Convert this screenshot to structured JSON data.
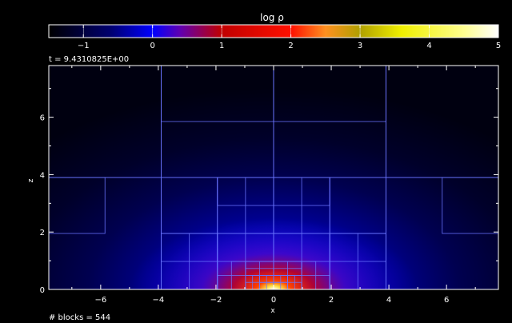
{
  "chart_data": {
    "type": "heatmap",
    "title": "log ρ",
    "colorbar": {
      "range": [
        -1.5,
        5.0
      ],
      "ticks": [
        -1,
        0,
        1,
        2,
        3,
        4,
        5
      ],
      "tick_labels": [
        "−1",
        "0",
        "1",
        "2",
        "3",
        "4",
        "5"
      ],
      "stops": [
        {
          "v": -1.5,
          "c": "#000000"
        },
        {
          "v": -0.6,
          "c": "#000070"
        },
        {
          "v": 0.0,
          "c": "#0000ff"
        },
        {
          "v": 0.4,
          "c": "#6000b0"
        },
        {
          "v": 1.0,
          "c": "#c00000"
        },
        {
          "v": 2.0,
          "c": "#ff1000"
        },
        {
          "v": 2.5,
          "c": "#ff9020"
        },
        {
          "v": 3.0,
          "c": "#b0a000"
        },
        {
          "v": 3.6,
          "c": "#f0f000"
        },
        {
          "v": 4.5,
          "c": "#ffff90"
        },
        {
          "v": 5.0,
          "c": "#ffffff"
        }
      ]
    },
    "time_label": "t = 9.4310825E+00",
    "blocks_label": "# blocks = 544",
    "xlabel": "x",
    "ylabel": "z",
    "xlim": [
      -7.8,
      7.8
    ],
    "ylim": [
      0,
      7.8
    ],
    "xticks": [
      -6,
      -4,
      -2,
      0,
      2,
      4,
      6
    ],
    "yticks": [
      0,
      2,
      4,
      6
    ],
    "grid_color": "#6a74ff",
    "blocks": [
      [
        -7.8,
        -3.9,
        3.9,
        7.8
      ],
      [
        -3.9,
        0,
        3.9,
        7.8
      ],
      [
        0,
        3.9,
        3.9,
        7.8
      ],
      [
        3.9,
        7.8,
        3.9,
        7.8
      ],
      [
        -3.9,
        0,
        5.85,
        7.8
      ],
      [
        0,
        3.9,
        5.85,
        7.8
      ],
      [
        -7.8,
        -3.9,
        0,
        3.9
      ],
      [
        3.9,
        7.8,
        0,
        3.9
      ],
      [
        -7.8,
        -5.85,
        1.95,
        3.9
      ],
      [
        5.85,
        7.8,
        1.95,
        3.9
      ],
      [
        -3.9,
        -1.95,
        1.95,
        3.9
      ],
      [
        1.95,
        3.9,
        1.95,
        3.9
      ],
      [
        -1.95,
        0,
        1.95,
        3.9
      ],
      [
        0,
        1.95,
        1.95,
        3.9
      ],
      [
        -1.95,
        0,
        2.925,
        3.9
      ],
      [
        0,
        1.95,
        2.925,
        3.9
      ],
      [
        -0.975,
        0,
        1.95,
        3.9
      ],
      [
        0,
        0.975,
        1.95,
        3.9
      ],
      [
        -3.9,
        -1.95,
        0,
        1.95
      ],
      [
        1.95,
        3.9,
        0,
        1.95
      ],
      [
        -3.9,
        -1.95,
        0.975,
        1.95
      ],
      [
        1.95,
        3.9,
        0.975,
        1.95
      ],
      [
        -2.925,
        -1.95,
        0,
        1.95
      ],
      [
        1.95,
        2.925,
        0,
        1.95
      ],
      [
        -1.95,
        0,
        0,
        1.95
      ],
      [
        0,
        1.95,
        0,
        1.95
      ],
      [
        -0.975,
        0,
        0,
        1.95
      ],
      [
        0,
        0.975,
        0,
        1.95
      ],
      [
        -1.95,
        0,
        0,
        0.975
      ],
      [
        0,
        1.95,
        0,
        0.975
      ],
      [
        -1.4625,
        -0.975,
        0,
        0.975
      ],
      [
        0.975,
        1.4625,
        0,
        0.975
      ],
      [
        -1.95,
        0,
        0,
        0.4875
      ],
      [
        0,
        1.95,
        0,
        0.4875
      ],
      [
        -0.4875,
        0,
        0,
        0.975
      ],
      [
        0,
        0.4875,
        0,
        0.975
      ],
      [
        -0.975,
        0,
        0.4875,
        0.975
      ],
      [
        0,
        0.975,
        0.4875,
        0.975
      ],
      [
        -0.975,
        0,
        0,
        0.24375
      ],
      [
        0,
        0.975,
        0,
        0.24375
      ],
      [
        -0.24375,
        0,
        0,
        0.4875
      ],
      [
        0,
        0.24375,
        0,
        0.4875
      ],
      [
        -0.73125,
        -0.4875,
        0,
        0.4875
      ],
      [
        0.4875,
        0.73125,
        0,
        0.4875
      ],
      [
        -0.975,
        0,
        0.73125,
        0.975
      ],
      [
        0,
        0.975,
        0.73125,
        0.975
      ],
      [
        -0.4875,
        0,
        0.24375,
        0.4875
      ],
      [
        0,
        0.4875,
        0.24375,
        0.4875
      ]
    ]
  }
}
